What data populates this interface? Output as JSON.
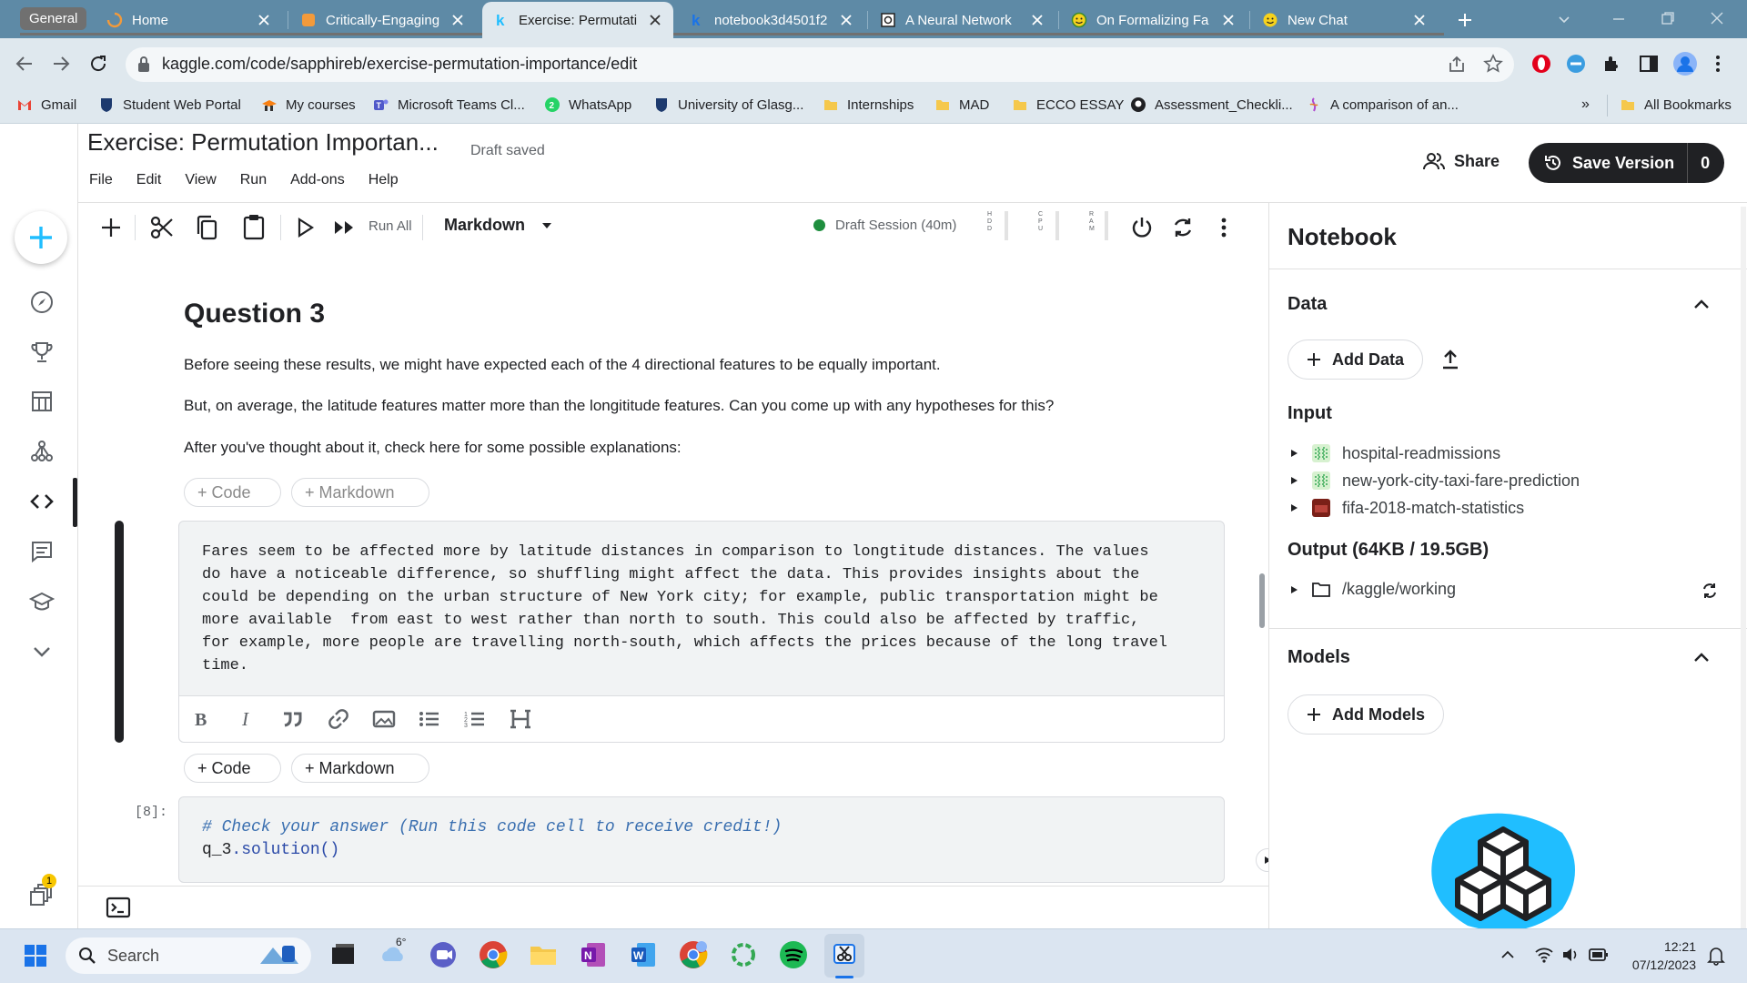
{
  "browser": {
    "tab_group_label": "General",
    "tabs": [
      {
        "title": "Home",
        "active": false
      },
      {
        "title": "Critically-Engaging",
        "active": false
      },
      {
        "title": "Exercise: Permutati",
        "active": true
      },
      {
        "title": "notebook3d4501f2",
        "active": false
      },
      {
        "title": "A Neural Network",
        "active": false
      },
      {
        "title": "On Formalizing Fa",
        "active": false
      },
      {
        "title": "New Chat",
        "active": false
      }
    ],
    "url": "kaggle.com/code/sapphireb/exercise-permutation-importance/edit",
    "bookmarks": [
      "Gmail",
      "Student Web Portal",
      "My courses",
      "Microsoft Teams Cl...",
      "WhatsApp",
      "University of Glasg...",
      "Internships",
      "MAD",
      "ECCO ESSAY",
      "Assessment_Checkli...",
      "A comparison of an..."
    ],
    "all_bookmarks": "All Bookmarks"
  },
  "kaggle": {
    "notebook_title": "Exercise: Permutation Importan...",
    "save_status": "Draft saved",
    "menu": [
      "File",
      "Edit",
      "View",
      "Run",
      "Add-ons",
      "Help"
    ],
    "share_label": "Share",
    "save_version_label": "Save Version",
    "version_count": "0",
    "toolbar": {
      "run_all": "Run All",
      "cell_type": "Markdown",
      "session": "Draft Session (40m)",
      "hdd": "HDD",
      "cpu": "CPU",
      "ram": "RAM"
    },
    "content": {
      "heading": "Question 3",
      "para1": "Before seeing these results, we might have expected each of the 4 directional features to be equally important.",
      "para2": "But, on average, the latitude features matter more than the longititude features. Can you come up with any hypotheses for this?",
      "para3": "After you've thought about it, check here for some possible explanations:",
      "add_code": "+ Code",
      "add_markdown": "+ Markdown",
      "answer_lines": [
        "Fares seem to be affected more by latitude distances in comparison to longtitude distances. The values",
        "do have a noticeable difference, so shuffling might affect the data. This provides insights about the",
        "could be depending on the urban structure of New York city; for example, public transportation might be",
        "more available  from east to west rather than north to south. This could also be affected by traffic,",
        "for example, more people are travelling north-south, which affects the prices because of the long travel",
        "time."
      ],
      "exec_count": "[8]:",
      "code_comment": "# Check your answer (Run this code cell to receive credit!)",
      "code_obj": "q_3",
      "code_method": ".solution()"
    },
    "sidebar": {
      "title": "Notebook",
      "data_section": "Data",
      "add_data": "Add Data",
      "input_label": "Input",
      "inputs": [
        "hospital-readmissions",
        "new-york-city-taxi-fare-prediction",
        "fifa-2018-match-statistics"
      ],
      "output_label": "Output (64KB / 19.5GB)",
      "output_path": "/kaggle/working",
      "models_section": "Models",
      "add_models": "Add Models"
    },
    "notification_count": "1"
  },
  "taskbar": {
    "search_placeholder": "Search",
    "weather": "6°",
    "time": "12:21",
    "date": "07/12/2023"
  },
  "colors": {
    "kaggle_blue": "#20beff",
    "tab_bar": "#5e8aa6",
    "toolbar_bg": "#dfe8ee"
  }
}
